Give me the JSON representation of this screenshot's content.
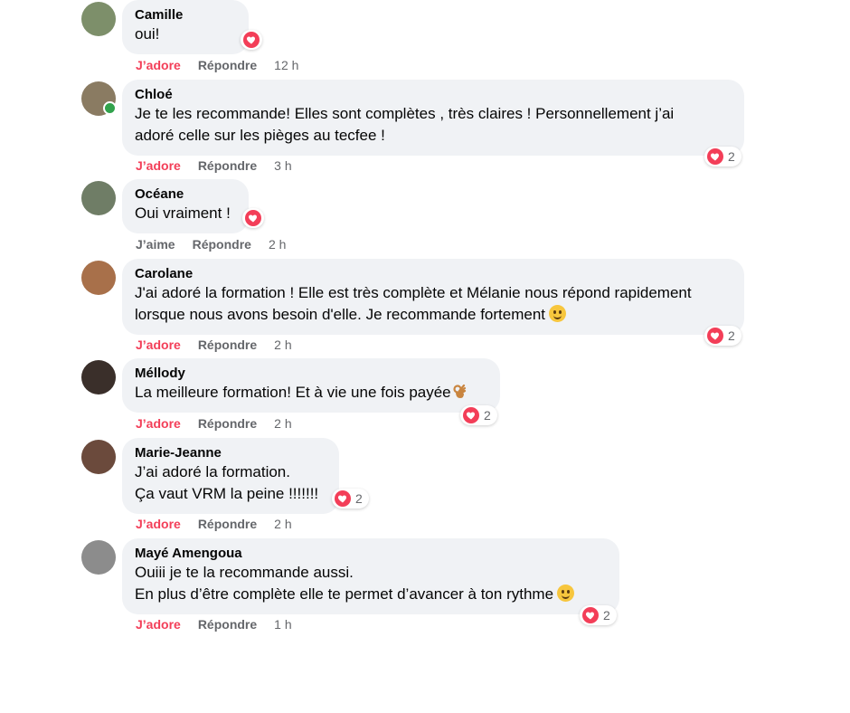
{
  "actions": {
    "adore": "J’adore",
    "aime": "J’aime",
    "reply": "Répondre"
  },
  "colors": {
    "heart": "#f33e58",
    "bubble": "#f0f2f5",
    "meta": "#65676b",
    "online": "#31a24c"
  },
  "comments": [
    {
      "author": "Camille",
      "text": "oui!",
      "time": "12 h",
      "like": "J’adore",
      "reactions": ""
    },
    {
      "author": "Chloé",
      "text": "Je te les  recommande! Elles sont complètes , très claires ! Personnellement j’ai\nadoré   celle sur les pièges au tecfee !",
      "time": "3 h",
      "like": "J’adore",
      "reactions": "2"
    },
    {
      "author": "Océane",
      "text": "Oui vraiment !",
      "time": "2 h",
      "like": "J’aime",
      "reactions": ""
    },
    {
      "author": "Carolane",
      "text": "J'ai adoré la formation ! Elle est très complète et Mélanie nous répond rapidement\nlorsque nous avons besoin d'elle. Je recommande fortement",
      "time": "2 h",
      "like": "J’adore",
      "reactions": "2"
    },
    {
      "author": "Méllody",
      "text": "La meilleure formation! Et à vie une fois payée",
      "time": "2 h",
      "like": "J’adore",
      "reactions": "2"
    },
    {
      "author": "Marie-Jeanne",
      "text": "J’ai adoré la formation.\nÇa vaut VRM la peine !!!!!!!",
      "time": "2 h",
      "like": "J’adore",
      "reactions": "2"
    },
    {
      "author": "Mayé Amengoua",
      "text": "Ouiii je te la recommande aussi.\nEn plus d’être complète elle te permet d’avancer à ton rythme",
      "time": "1 h",
      "like": "J’adore",
      "reactions": "2"
    }
  ]
}
